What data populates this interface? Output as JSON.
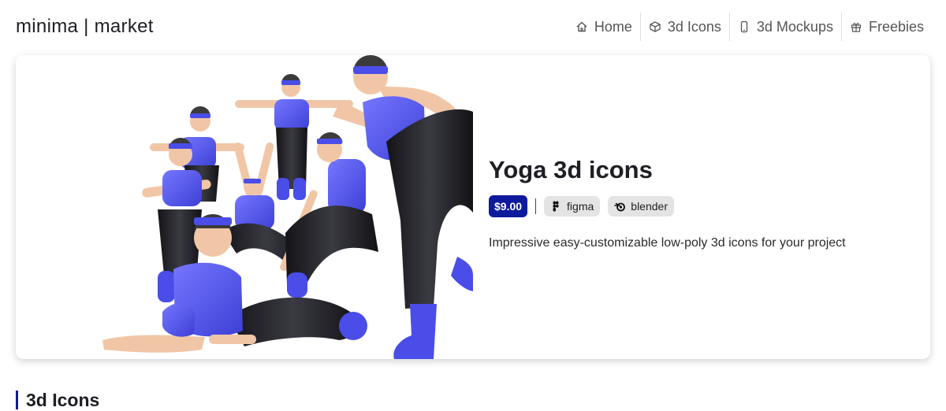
{
  "brand": "minima | market",
  "nav": [
    {
      "label": "Home",
      "icon": "home-icon"
    },
    {
      "label": "3d Icons",
      "icon": "cube-icon"
    },
    {
      "label": "3d Mockups",
      "icon": "phone-icon"
    },
    {
      "label": "Freebies",
      "icon": "gift-icon"
    }
  ],
  "product": {
    "title": "Yoga 3d icons",
    "price": "$9.00",
    "tags": [
      {
        "label": "figma",
        "icon": "figma-icon"
      },
      {
        "label": "blender",
        "icon": "blender-icon"
      }
    ],
    "description": "Impressive easy-customizable low-poly 3d icons for your project"
  },
  "section": {
    "title": "3d Icons"
  },
  "colors": {
    "accent": "#0e1a9c",
    "figure_shirt": "#5b5ef0",
    "figure_pants": "#222228",
    "figure_skin": "#f1c6a6"
  }
}
